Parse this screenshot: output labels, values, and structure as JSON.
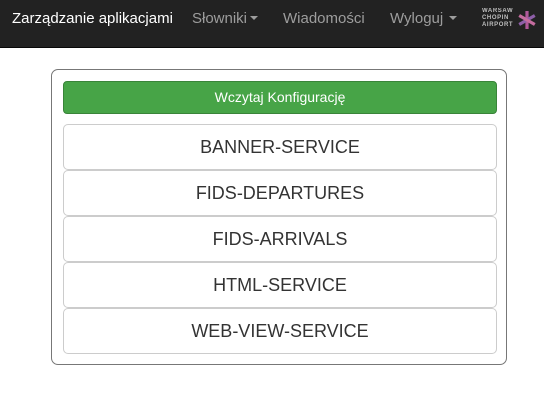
{
  "navbar": {
    "brand": "Zarządzanie aplikacjami",
    "items": [
      {
        "label": "Słowniki",
        "dropdown": true
      },
      {
        "label": "Wiadomości",
        "dropdown": false
      },
      {
        "label": "Wyloguj",
        "dropdown": true
      }
    ],
    "logo": {
      "lines": [
        "WARSAW",
        "CHOPIN",
        "AIRPORT"
      ],
      "icon": "chopin-airport-star-icon"
    },
    "colors": {
      "background": "#222222",
      "text": "#9d9d9d",
      "brand": "#ffffff"
    }
  },
  "panel": {
    "load_button": "Wczytaj Konfigurację",
    "services": [
      "BANNER-SERVICE",
      "FIDS-DEPARTURES",
      "FIDS-ARRIVALS",
      "HTML-SERVICE",
      "WEB-VIEW-SERVICE"
    ],
    "colors": {
      "load_button": "#47a447",
      "border": "#777777"
    }
  }
}
